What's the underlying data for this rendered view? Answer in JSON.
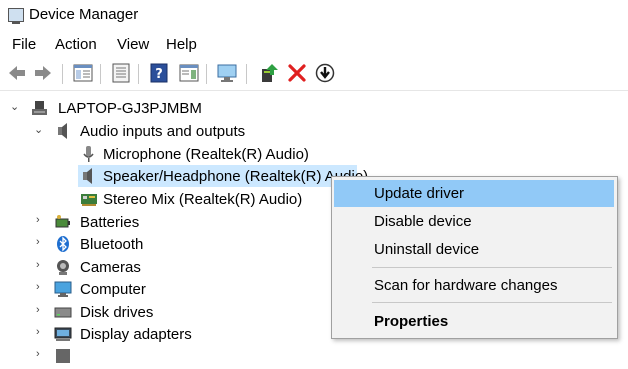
{
  "window": {
    "title": "Device Manager"
  },
  "menu": [
    "File",
    "Action",
    "View",
    "Help"
  ],
  "toolbar": [
    "back-icon",
    "forward-icon",
    "show-hide-console-tree-icon",
    "properties-icon",
    "help-icon",
    "action-pane-icon",
    "monitor-icon",
    "update-driver-icon",
    "uninstall-icon",
    "disable-icon"
  ],
  "tree": {
    "root": "LAPTOP-GJ3PJMBM",
    "audio": "Audio inputs and outputs",
    "microphone": "Microphone (Realtek(R) Audio)",
    "speaker": "Speaker/Headphone (Realtek(R) Audio)",
    "stereo": "Stereo Mix (Realtek(R) Audio)",
    "batteries": "Batteries",
    "bluetooth": "Bluetooth",
    "cameras": "Cameras",
    "computer": "Computer",
    "disk": "Disk drives",
    "display": "Display adapters"
  },
  "context_menu": {
    "update": "Update driver",
    "disable": "Disable device",
    "uninstall": "Uninstall device",
    "scan": "Scan for hardware changes",
    "properties": "Properties"
  },
  "colors": {
    "selection": "#cce8ff",
    "menu_highlight": "#91c9f7",
    "menu_bg": "#f2f2f2"
  }
}
